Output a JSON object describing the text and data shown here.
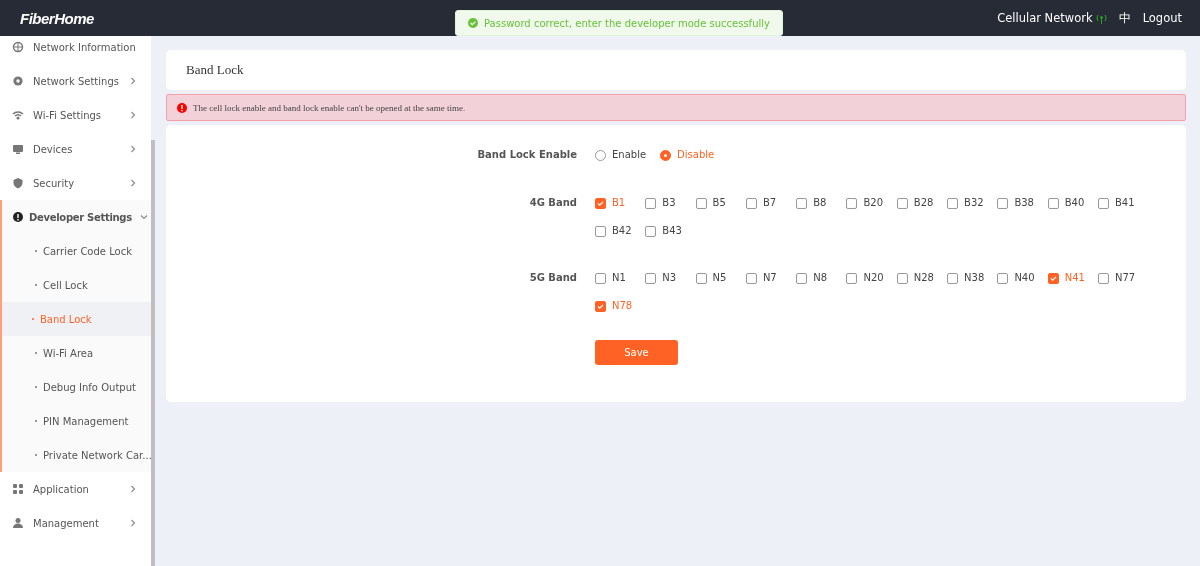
{
  "header": {
    "logo": "FiberHome",
    "toast": "Password correct, enter the developer mode successfully",
    "network": "Cellular Network",
    "language": "中",
    "logout": "Logout"
  },
  "sidebar": {
    "items": [
      {
        "label": "Network Information",
        "expanded": false
      },
      {
        "label": "Network Settings",
        "expanded": false
      },
      {
        "label": "Wi-Fi Settings",
        "expanded": false
      },
      {
        "label": "Devices",
        "expanded": false
      },
      {
        "label": "Security",
        "expanded": false
      },
      {
        "label": "Developer Settings",
        "expanded": true,
        "children": [
          {
            "label": "Carrier Code Lock",
            "selected": false
          },
          {
            "label": "Cell Lock",
            "selected": false
          },
          {
            "label": "Band Lock",
            "selected": true
          },
          {
            "label": "Wi-Fi Area",
            "selected": false
          },
          {
            "label": "Debug Info Output",
            "selected": false
          },
          {
            "label": "PIN Management",
            "selected": false
          },
          {
            "label": "Private Network Car...",
            "selected": false
          }
        ]
      },
      {
        "label": "Application",
        "expanded": false
      },
      {
        "label": "Management",
        "expanded": false
      }
    ]
  },
  "page_title": "Band Lock",
  "alert": "The cell lock enable and band lock enable can't be opened at the same time.",
  "form": {
    "enable": {
      "label": "Band Lock Enable",
      "options": [
        {
          "label": "Enable",
          "selected": false
        },
        {
          "label": "Disable",
          "selected": true
        }
      ]
    },
    "bands": [
      {
        "label": "4G Band",
        "options": [
          {
            "label": "B1",
            "checked": true
          },
          {
            "label": "B3",
            "checked": false
          },
          {
            "label": "B5",
            "checked": false
          },
          {
            "label": "B7",
            "checked": false
          },
          {
            "label": "B8",
            "checked": false
          },
          {
            "label": "B20",
            "checked": false
          },
          {
            "label": "B28",
            "checked": false
          },
          {
            "label": "B32",
            "checked": false
          },
          {
            "label": "B38",
            "checked": false
          },
          {
            "label": "B40",
            "checked": false
          },
          {
            "label": "B41",
            "checked": false
          },
          {
            "label": "B42",
            "checked": false
          },
          {
            "label": "B43",
            "checked": false
          }
        ]
      },
      {
        "label": "5G Band",
        "options": [
          {
            "label": "N1",
            "checked": false
          },
          {
            "label": "N3",
            "checked": false
          },
          {
            "label": "N5",
            "checked": false
          },
          {
            "label": "N7",
            "checked": false
          },
          {
            "label": "N8",
            "checked": false
          },
          {
            "label": "N20",
            "checked": false
          },
          {
            "label": "N28",
            "checked": false
          },
          {
            "label": "N38",
            "checked": false
          },
          {
            "label": "N40",
            "checked": false
          },
          {
            "label": "N41",
            "checked": true
          },
          {
            "label": "N77",
            "checked": false
          },
          {
            "label": "N78",
            "checked": true
          }
        ]
      }
    ],
    "save": "Save"
  }
}
